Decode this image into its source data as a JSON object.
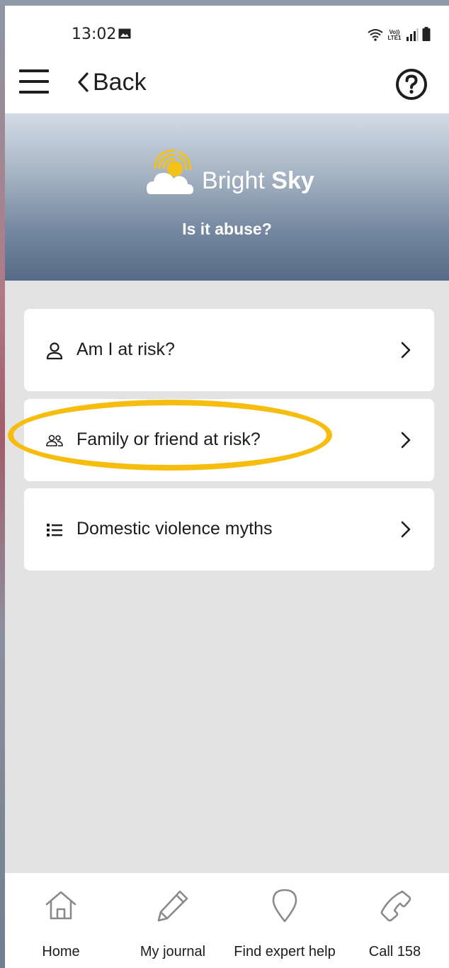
{
  "status_bar": {
    "time": "13:02",
    "network_label": "Vo)) LTE1"
  },
  "app_bar": {
    "back_label": "Back",
    "menu_icon": "hamburger-menu-icon",
    "help_icon": "question-circle-icon"
  },
  "hero": {
    "logo_text_light": "Bright",
    "logo_text_bold": "Sky",
    "subtitle": "Is it abuse?"
  },
  "menu": {
    "items": [
      {
        "label": "Am I at risk?",
        "icon": "person-icon"
      },
      {
        "label": "Family or friend at risk?",
        "icon": "people-icon"
      },
      {
        "label": "Domestic violence myths",
        "icon": "list-icon"
      }
    ],
    "highlighted_index": 1
  },
  "bottom_nav": {
    "items": [
      {
        "label": "Home",
        "icon": "home-icon"
      },
      {
        "label": "My journal",
        "icon": "pencil-icon"
      },
      {
        "label": "Find expert help",
        "icon": "map-pin-icon"
      },
      {
        "label": "Call 158",
        "icon": "phone-icon"
      }
    ]
  },
  "colors": {
    "highlight": "#f7bd0e",
    "hero_top": "#d2dce6",
    "hero_bottom": "#566c86",
    "background": "#e3e3e3"
  }
}
